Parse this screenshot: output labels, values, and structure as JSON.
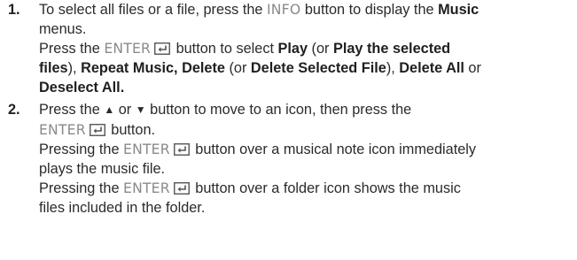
{
  "steps": [
    {
      "number": "1.",
      "l1_a": "To select all files or a file, press the ",
      "l1_key": "INFO",
      "l1_b": " button to display the ",
      "l1_bold": "Music",
      "l2": "menus.",
      "l3_a": "Press the ",
      "l3_key": "ENTER",
      "l3_b": " button to select ",
      "l3_bold1": "Play",
      "l3_c": " (or ",
      "l3_bold2": "Play the selected",
      "l4_bold1": "files",
      "l4_a": "), ",
      "l4_bold2": "Repeat Music, Delete",
      "l4_b": " (or ",
      "l4_bold3": "Delete Selected File",
      "l4_c": "), ",
      "l4_bold4": "Delete All",
      "l4_d": " or",
      "l5_bold": "Deselect All."
    },
    {
      "number": "2.",
      "l1_a": "Press the ",
      "l1_up": "▲",
      "l1_b": " or ",
      "l1_down": "▼",
      "l1_c": " button to move to an icon, then press the",
      "l2_key": "ENTER",
      "l2_a": " button.",
      "l3_a": "Pressing the ",
      "l3_key": "ENTER",
      "l3_b": " button over a musical note icon immediately",
      "l4": "plays the music file.",
      "l5_a": "Pressing the ",
      "l5_key": "ENTER",
      "l5_b": " button over a folder icon shows the music",
      "l6": "files included in the folder."
    }
  ],
  "icons": {
    "enter": "enter-key-icon",
    "up": "up-arrow-icon",
    "down": "down-arrow-icon"
  }
}
